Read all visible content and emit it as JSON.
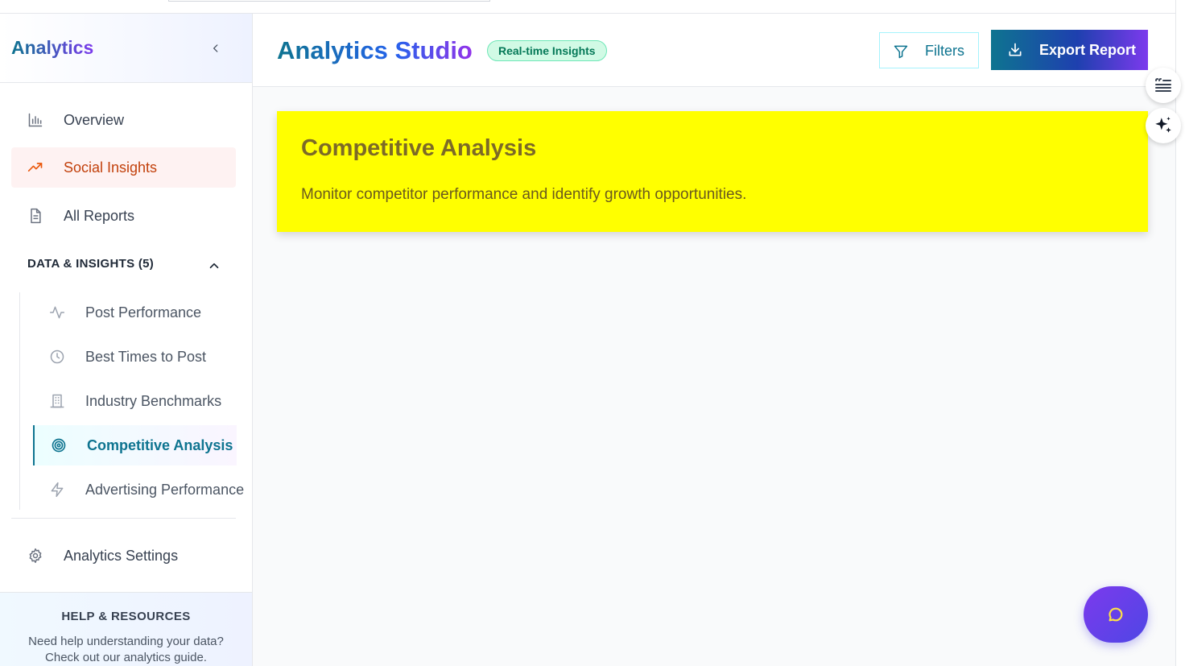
{
  "sidebar": {
    "title": "Analytics",
    "nav": [
      {
        "label": "Overview",
        "icon": "bar-chart-icon"
      },
      {
        "label": "Social Insights",
        "icon": "trending-up-icon"
      },
      {
        "label": "All Reports",
        "icon": "document-icon"
      }
    ],
    "section": {
      "label": "DATA & INSIGHTS (5)"
    },
    "sub_items": [
      {
        "label": "Post Performance",
        "icon": "activity-icon"
      },
      {
        "label": "Best Times to Post",
        "icon": "clock-icon"
      },
      {
        "label": "Industry Benchmarks",
        "icon": "building-icon"
      },
      {
        "label": "Competitive Analysis",
        "icon": "target-icon"
      },
      {
        "label": "Advertising Performance",
        "icon": "bolt-icon"
      }
    ],
    "settings": {
      "label": "Analytics Settings",
      "icon": "gear-icon"
    },
    "help": {
      "heading": "HELP & RESOURCES",
      "line1": "Need help understanding your data?",
      "line2": "Check out our analytics guide."
    }
  },
  "header": {
    "title": "Analytics Studio",
    "badge": "Real-time Insights",
    "filters_label": "Filters",
    "export_label": "Export Report"
  },
  "main": {
    "card": {
      "title": "Competitive Analysis",
      "description": "Monitor competitor performance and identify growth opportunities."
    }
  },
  "colors": {
    "accent_teal": "#0e7490",
    "accent_purple": "#7c3aed",
    "active_orange": "#c2410c",
    "card_yellow": "#ffff00",
    "badge_green": "#047857"
  }
}
